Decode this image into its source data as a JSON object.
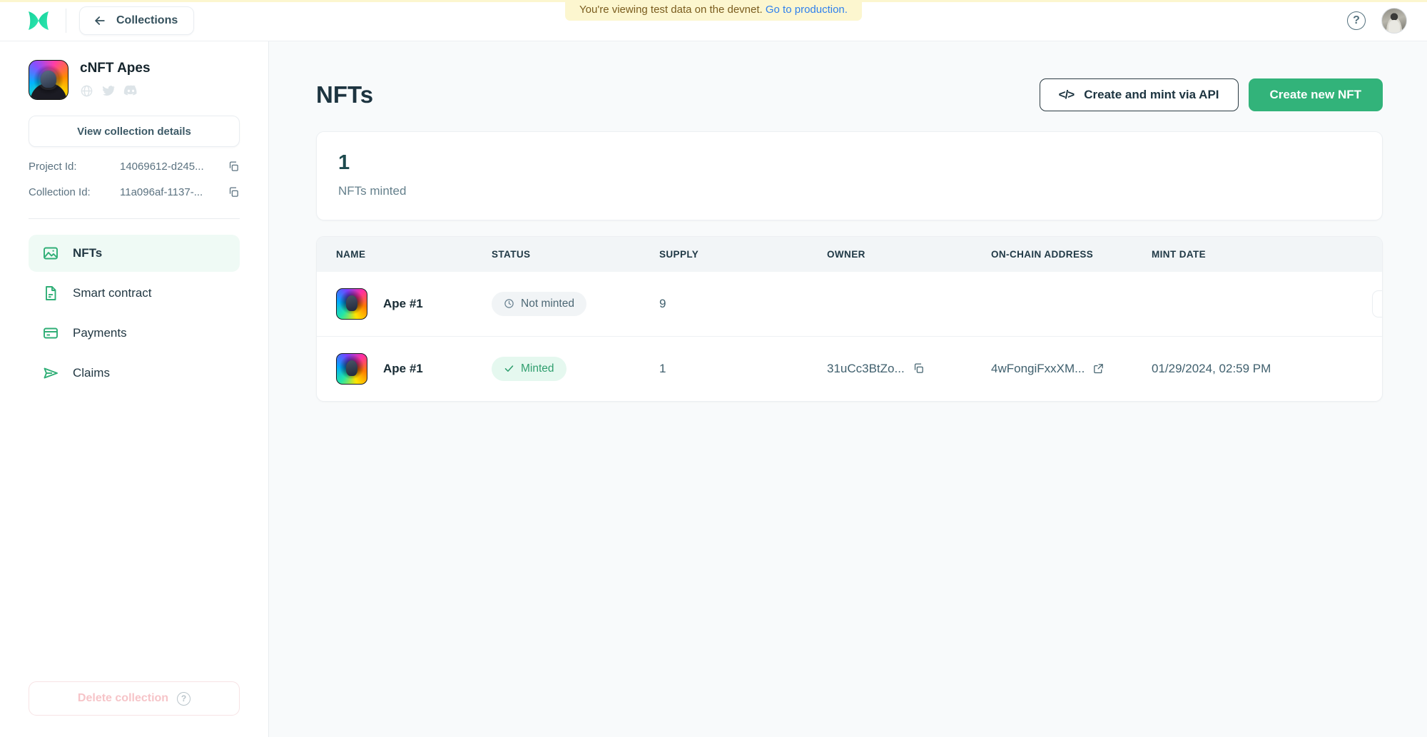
{
  "topbar": {
    "logo_icon": "underdog-x-logo",
    "collections_label": "Collections",
    "back_icon": "arrow-left-icon",
    "help_icon": "question-mark-icon",
    "help_label": "?",
    "avatar_icon": "user-avatar",
    "accent_green": "#32b37a"
  },
  "banner": {
    "text": "You're viewing test data on the devnet.",
    "link": "Go to production.",
    "bg": "#fcf6cf",
    "text_color": "#7a5c1e",
    "link_color": "#2f80ed"
  },
  "sidebar": {
    "collection_name": "cNFT Apes",
    "socials": [
      {
        "name": "globe-icon"
      },
      {
        "name": "twitter-icon"
      },
      {
        "name": "discord-icon"
      }
    ],
    "view_details_label": "View collection details",
    "ids": [
      {
        "key": "Project Id:",
        "value": "14069612-d245...",
        "copy_icon": "copy-icon"
      },
      {
        "key": "Collection Id:",
        "value": "11a096af-1137-...",
        "copy_icon": "copy-icon"
      }
    ],
    "nav": [
      {
        "label": "NFTs",
        "icon": "image-icon",
        "active": true
      },
      {
        "label": "Smart contract",
        "icon": "document-icon",
        "active": false
      },
      {
        "label": "Payments",
        "icon": "credit-card-icon",
        "active": false
      },
      {
        "label": "Claims",
        "icon": "send-icon",
        "active": false
      }
    ],
    "delete_label": "Delete collection",
    "delete_help_label": "?",
    "delete_disabled": true
  },
  "main": {
    "page_title": "NFTs",
    "create_api_label": "Create and mint via API",
    "create_api_icon": "code-brackets-icon",
    "create_nft_label": "Create new NFT",
    "stat": {
      "value": "1",
      "label": "NFTs minted"
    },
    "table": {
      "columns": [
        "NAME",
        "STATUS",
        "SUPPLY",
        "OWNER",
        "ON-CHAIN ADDRESS",
        "MINT DATE"
      ],
      "rows": [
        {
          "name": "Ape #1",
          "thumb_icon": "nft-thumbnail",
          "status": "Not minted",
          "status_type": "notminted",
          "status_icon": "clock-icon",
          "supply": "9",
          "owner": "",
          "owner_copy_icon": "",
          "address": "",
          "address_link_icon": "",
          "mint_date": "",
          "has_menu": true,
          "menu_icon": "kebab-menu-icon"
        },
        {
          "name": "Ape #1",
          "thumb_icon": "nft-thumbnail",
          "status": "Minted",
          "status_type": "minted",
          "status_icon": "check-icon",
          "supply": "1",
          "owner": "31uCc3BtZo...",
          "owner_copy_icon": "copy-icon",
          "address": "4wFongiFxxXM...",
          "address_link_icon": "external-link-icon",
          "mint_date": "01/29/2024, 02:59 PM",
          "has_menu": false,
          "menu_icon": ""
        }
      ]
    }
  }
}
